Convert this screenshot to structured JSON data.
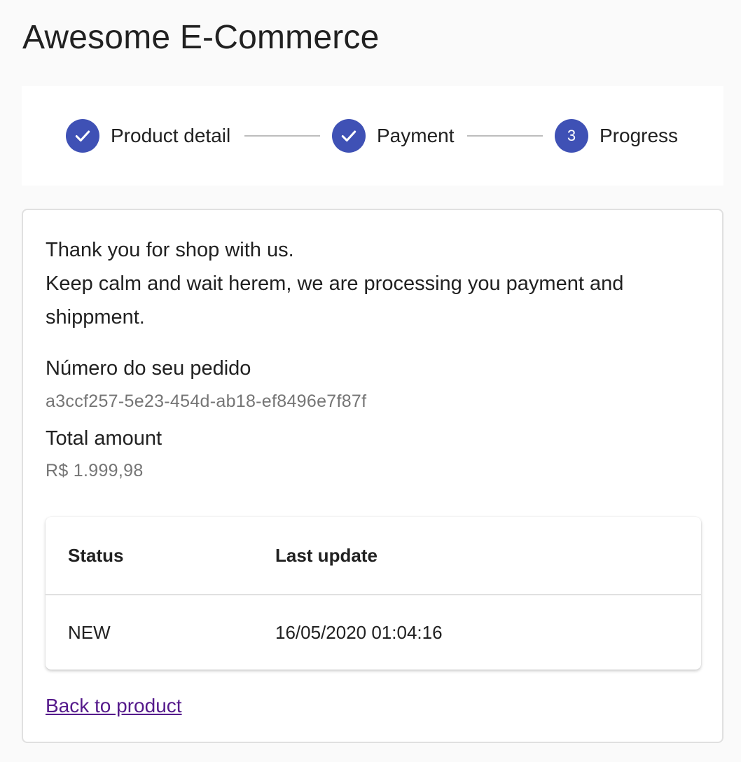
{
  "app": {
    "title": "Awesome E-Commerce"
  },
  "stepper": {
    "steps": [
      {
        "label": "Product detail",
        "state": "completed",
        "icon": "check-icon"
      },
      {
        "label": "Payment",
        "state": "completed",
        "icon": "check-icon"
      },
      {
        "label": "Progress",
        "state": "active",
        "number": "3"
      }
    ],
    "accent_color": "#3f51b5"
  },
  "order": {
    "message_line1": "Thank you for shop with us.",
    "message_line2": "Keep calm and wait herem, we are processing you payment and",
    "message_line3": "shippment.",
    "order_number_label": "Número do seu pedido",
    "order_number_value": "a3ccf257-5e23-454d-ab18-ef8496e7f87f",
    "total_label": "Total amount",
    "total_value": "R$ 1.999,98"
  },
  "status_table": {
    "columns": [
      "Status",
      "Last update"
    ],
    "rows": [
      [
        "NEW",
        "16/05/2020 01:04:16"
      ]
    ]
  },
  "links": {
    "back_to_product": "Back to product",
    "link_color": "#551a8b"
  }
}
